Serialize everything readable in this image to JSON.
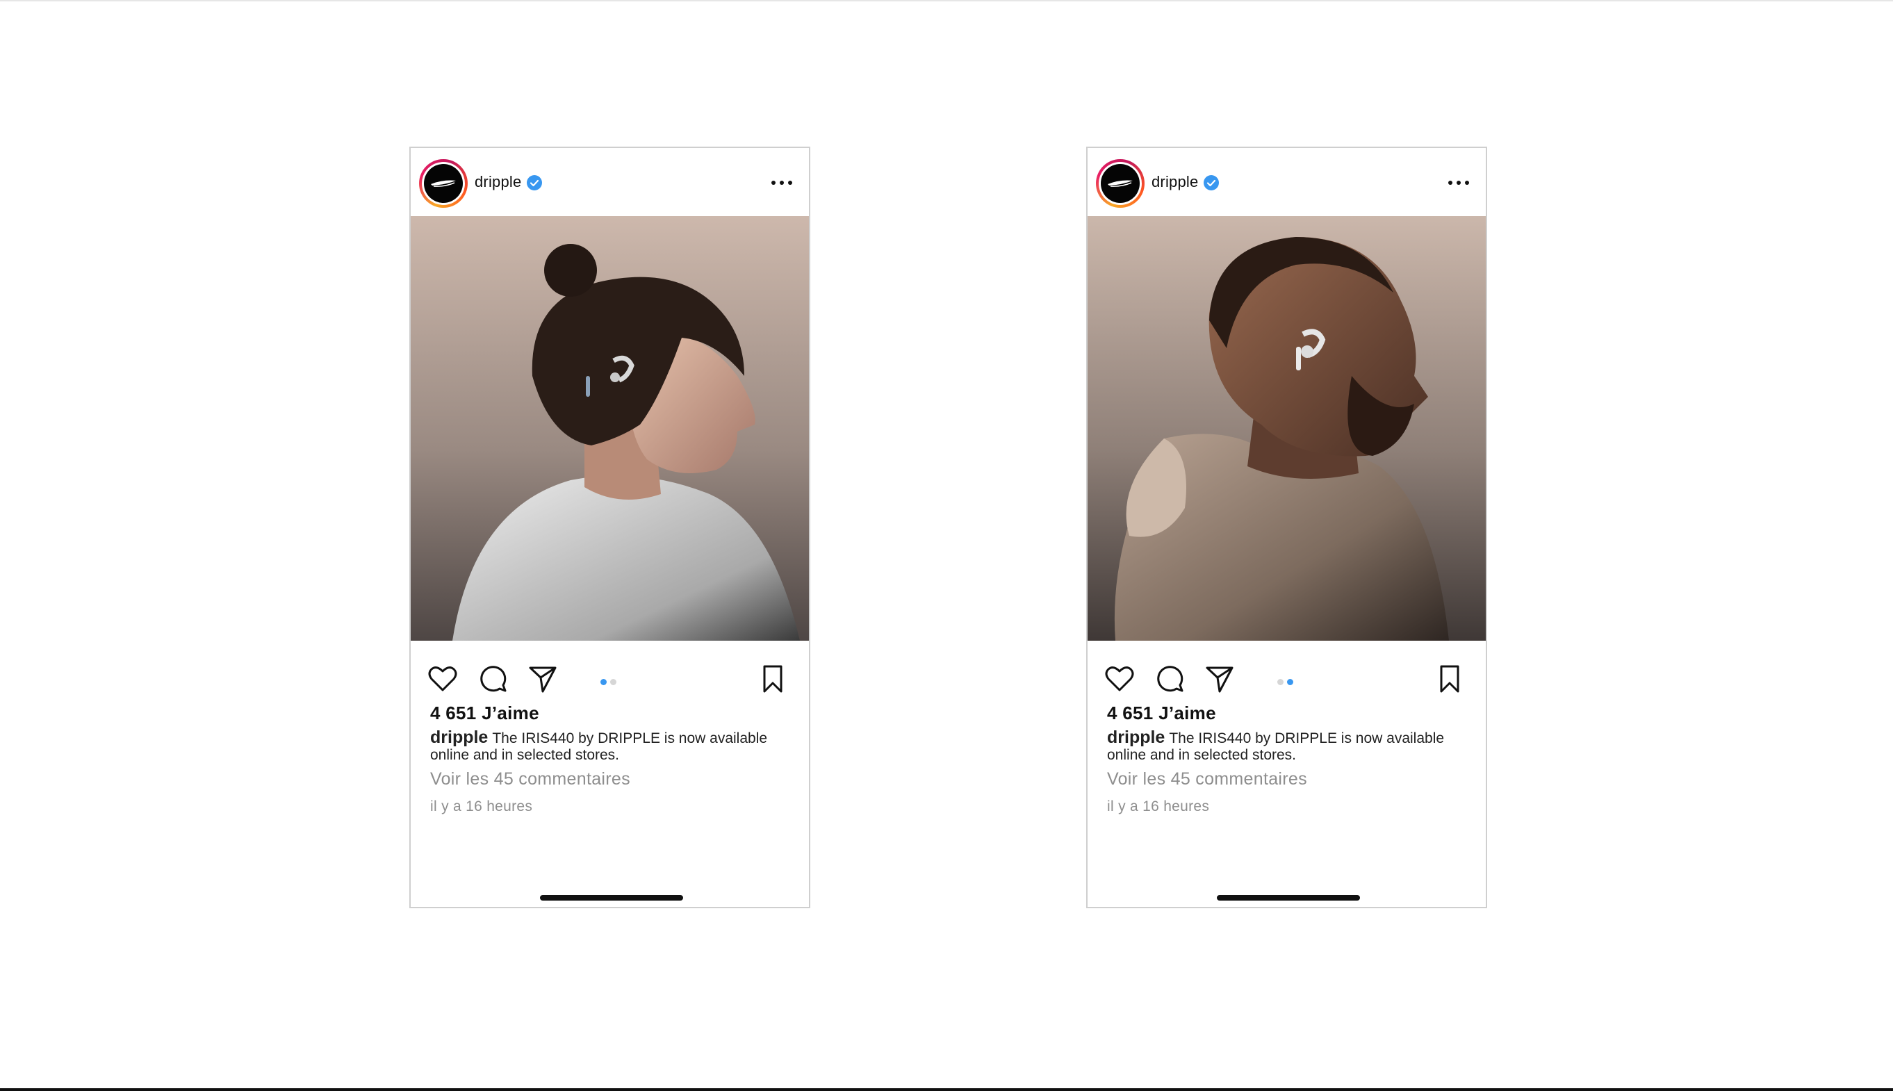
{
  "posts": [
    {
      "username": "dripple",
      "likes": "4 651 J’aime",
      "caption_user": "dripple",
      "caption_text": "The IRIS440 by DRIPPLE is now available online and in selected stores.",
      "view_comments": "Voir les 45 commentaires",
      "timestamp": "il y a 16 heures",
      "carousel_active_index": 0,
      "carousel_count": 2,
      "image_subject": "woman-profile-earbud"
    },
    {
      "username": "dripple",
      "likes": "4 651 J’aime",
      "caption_user": "dripple",
      "caption_text": "The IRIS440 by DRIPPLE is now available online and in selected stores.",
      "view_comments": "Voir les 45 commentaires",
      "timestamp": "il y a 16 heures",
      "carousel_active_index": 1,
      "carousel_count": 2,
      "image_subject": "man-profile-earbud"
    }
  ],
  "icons": {
    "more": "more-options-icon",
    "like": "heart-icon",
    "comment": "comment-icon",
    "share": "share-icon",
    "save": "bookmark-icon",
    "verified": "verified-badge-icon"
  },
  "colors": {
    "verified": "#3897f0",
    "carousel_active": "#3897f0",
    "secondary_text": "#8e8e8e"
  }
}
